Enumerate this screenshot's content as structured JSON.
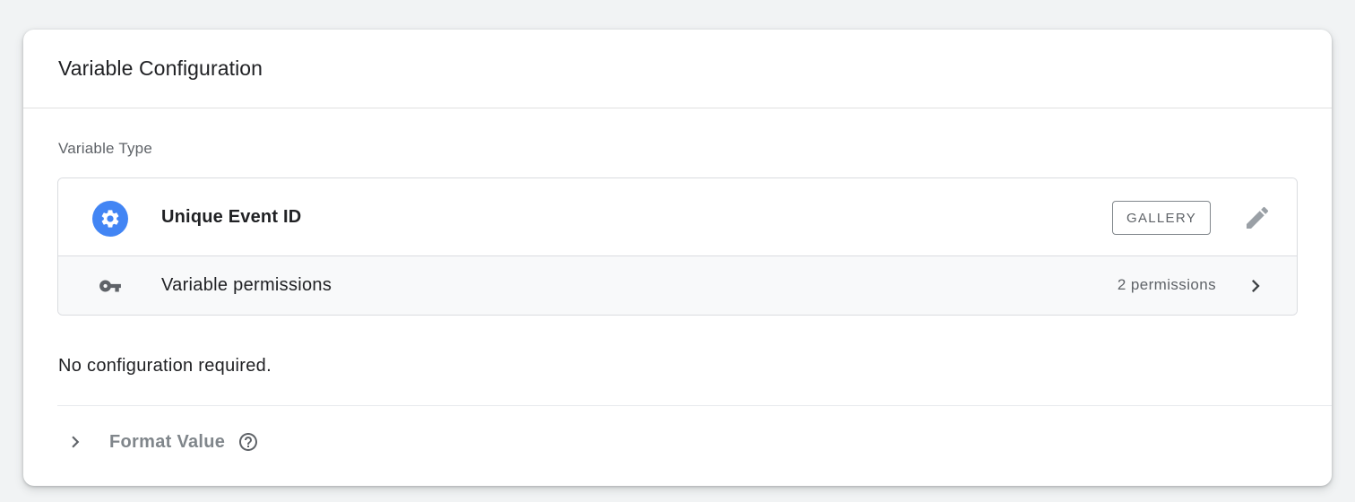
{
  "card": {
    "title": "Variable Configuration"
  },
  "variable_type": {
    "section_label": "Variable Type",
    "name": "Unique Event ID",
    "icon": "gear-icon",
    "icon_color": "#4285f4",
    "badge": "GALLERY",
    "edit_icon": "pencil-icon"
  },
  "permissions": {
    "label": "Variable permissions",
    "count": "2 permissions",
    "icon": "key-icon"
  },
  "body": {
    "message": "No configuration required."
  },
  "format_value": {
    "label": "Format Value",
    "help_icon": "help-icon"
  }
}
